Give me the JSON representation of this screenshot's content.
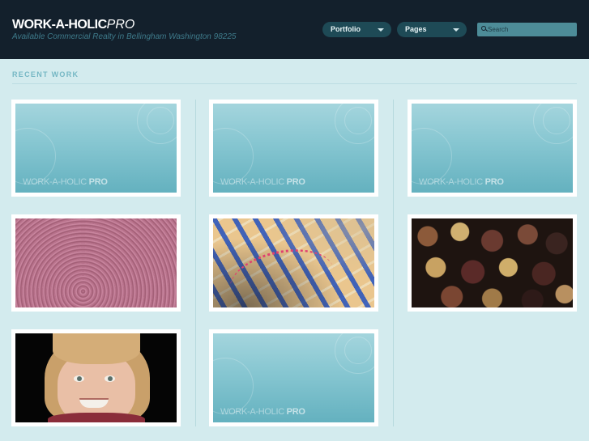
{
  "header": {
    "logo_main": "WORK-A-HOLIC",
    "logo_suffix": "PRO",
    "tagline": "Available Commercial Realty in Bellingham Washington 98225"
  },
  "nav": {
    "portfolio": "Portfolio",
    "pages": "Pages"
  },
  "search": {
    "placeholder": "Search"
  },
  "section": {
    "title": "RECENT WORK"
  },
  "placeholder_watermark": {
    "main": "WORK-A-HOLIC",
    "suffix": "PRO"
  },
  "colors": {
    "header_bg": "#13202c",
    "page_bg": "#d3ebee",
    "nav_button": "#1e4a56",
    "accent": "#75b7c4"
  }
}
